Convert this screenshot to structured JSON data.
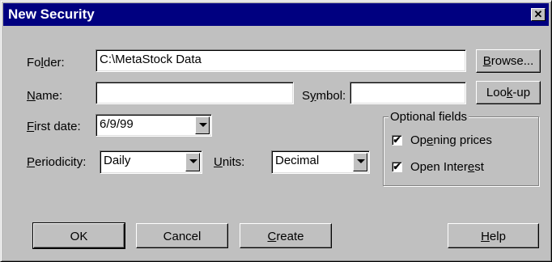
{
  "dialog": {
    "title": "New Security",
    "close_icon": "close-icon"
  },
  "folder": {
    "label_pre": "Fo",
    "label_u": "l",
    "label_post": "der:",
    "value": "C:\\MetaStock Data",
    "browse_pre": "",
    "browse_u": "B",
    "browse_post": "rowse..."
  },
  "name": {
    "label_pre": "",
    "label_u": "N",
    "label_post": "ame:",
    "value": ""
  },
  "symbol": {
    "label_pre": "S",
    "label_u": "y",
    "label_post": "mbol:",
    "value": "",
    "lookup_pre": "Loo",
    "lookup_u": "k",
    "lookup_post": "-up"
  },
  "first_date": {
    "label_pre": "",
    "label_u": "F",
    "label_post": "irst date:",
    "value": "6/9/99"
  },
  "periodicity": {
    "label_pre": "",
    "label_u": "P",
    "label_post": "eriodicity:",
    "value": "Daily"
  },
  "units": {
    "label_pre": "",
    "label_u": "U",
    "label_post": "nits:",
    "value": "Decimal"
  },
  "optional": {
    "title": "Optional fields",
    "opening_pre": "Op",
    "opening_u": "e",
    "opening_post": "ning prices",
    "opening_checked": "✔",
    "openint_pre": "Open Inter",
    "openint_u": "e",
    "openint_post": "st",
    "openint_checked": "✔"
  },
  "buttons": {
    "ok": "OK",
    "cancel": "Cancel",
    "create_u": "C",
    "create_post": "reate",
    "help_u": "H",
    "help_post": "elp"
  }
}
